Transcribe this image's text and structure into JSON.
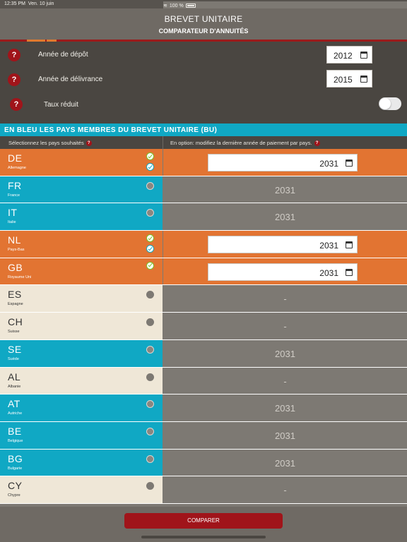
{
  "status_bar": {
    "time": "12:35 PM",
    "date": "Ven. 10 juin",
    "wifi": "wifi-icon",
    "battery": "100 %"
  },
  "header": {
    "title": "BREVET UNITAIRE",
    "subtitle": "COMPARATEUR D'ANNUITÉS"
  },
  "settings": {
    "filing_year_label": "Année de dépôt",
    "filing_year_value": "2012",
    "grant_year_label": "Année de délivrance",
    "grant_year_value": "2015",
    "reduced_rate_label": "Taux réduit",
    "reduced_rate_on": false,
    "help_glyph": "?"
  },
  "banner": "EN BLEU LES PAYS MEMBRES DU BREVET UNITAIRE (BU)",
  "columns": {
    "select_header": "Sélectionnez les pays souhaités",
    "option_header": "En option: modifiez la dernière année de paiement par pays."
  },
  "countries": [
    {
      "code": "DE",
      "name": "Allemagne",
      "state": "selected",
      "bu": true,
      "green": true,
      "blue": true,
      "year": "2031"
    },
    {
      "code": "FR",
      "name": "France",
      "state": "bu",
      "bu": true,
      "year": "2031"
    },
    {
      "code": "IT",
      "name": "Italie",
      "state": "bu",
      "bu": true,
      "year": "2031"
    },
    {
      "code": "NL",
      "name": "Pays-Bas",
      "state": "selected",
      "bu": true,
      "green": true,
      "blue": true,
      "year": "2031"
    },
    {
      "code": "GB",
      "name": "Royaume Uni",
      "state": "selected",
      "bu": false,
      "green": true,
      "blue": false,
      "year": "2031"
    },
    {
      "code": "ES",
      "name": "Espagne",
      "state": "no",
      "bu": false,
      "year": "-"
    },
    {
      "code": "CH",
      "name": "Suisse",
      "state": "no",
      "bu": false,
      "year": "-"
    },
    {
      "code": "SE",
      "name": "Suède",
      "state": "bu",
      "bu": true,
      "year": "2031"
    },
    {
      "code": "AL",
      "name": "Albanie",
      "state": "no",
      "bu": false,
      "year": "-"
    },
    {
      "code": "AT",
      "name": "Autriche",
      "state": "bu",
      "bu": true,
      "year": "2031"
    },
    {
      "code": "BE",
      "name": "Belgique",
      "state": "bu",
      "bu": true,
      "year": "2031"
    },
    {
      "code": "BG",
      "name": "Bulgarie",
      "state": "bu",
      "bu": true,
      "year": "2031"
    },
    {
      "code": "CY",
      "name": "Chypre",
      "state": "no",
      "bu": false,
      "year": "-"
    }
  ],
  "compare_button": "COMPARER",
  "colors": {
    "orange": "#e27432",
    "teal": "#10a8c4",
    "beige": "#efe7d7",
    "red": "#a0141a",
    "gray": "#7d7973"
  }
}
